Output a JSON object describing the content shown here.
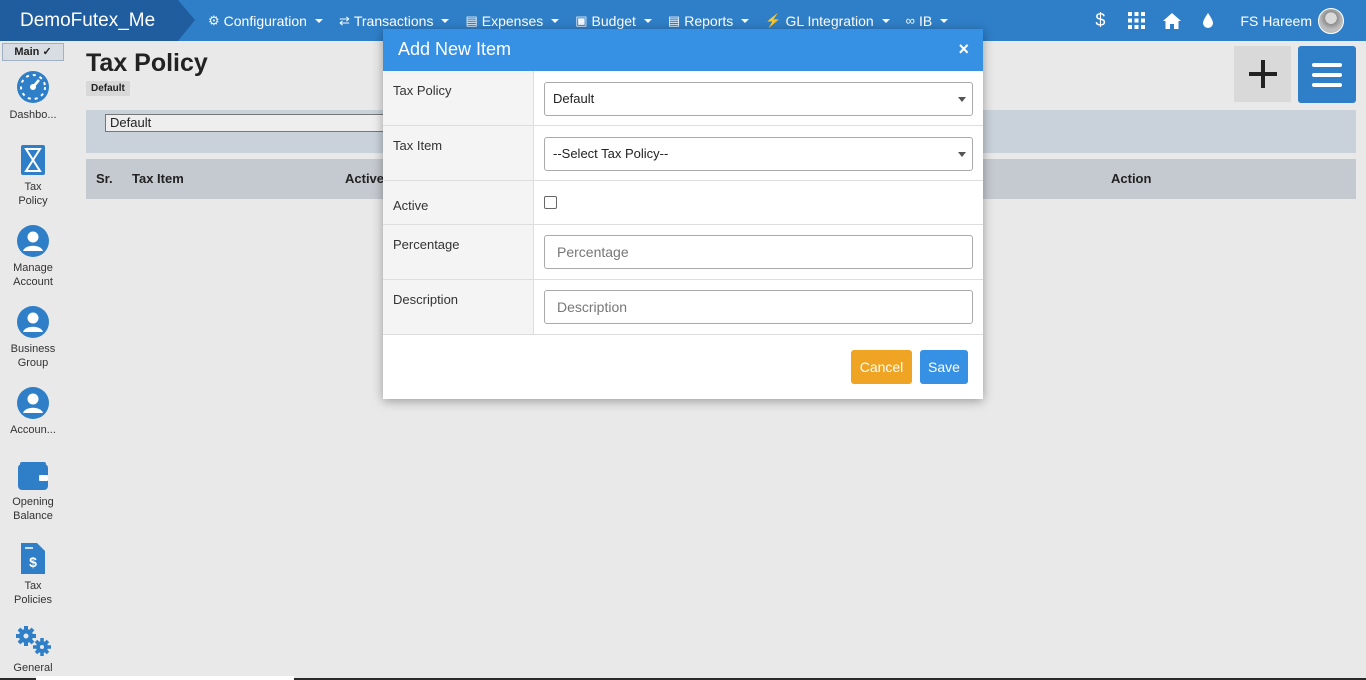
{
  "app": {
    "brand": "DemoFutex_Me"
  },
  "nav": {
    "items": [
      {
        "label": "Configuration",
        "icon": "gears-icon"
      },
      {
        "label": "Transactions",
        "icon": "exchange-icon"
      },
      {
        "label": "Expenses",
        "icon": "document-icon"
      },
      {
        "label": "Budget",
        "icon": "wallet-icon"
      },
      {
        "label": "Reports",
        "icon": "report-icon"
      },
      {
        "label": "GL Integration",
        "icon": "plug-icon"
      },
      {
        "label": "IB",
        "icon": "link-icon"
      }
    ],
    "right_icons": [
      "dollar-icon",
      "grid-icon",
      "home-icon",
      "drop-icon"
    ],
    "user_name": "FS Hareem"
  },
  "sidebar": {
    "main_tag": "Main ✓",
    "items": [
      {
        "label": "Dashbo...",
        "icon": "dashboard-icon"
      },
      {
        "label": "Tax Policy",
        "icon": "hourglass-icon"
      },
      {
        "label": "Manage Account",
        "icon": "user-icon"
      },
      {
        "label": "Business Group",
        "icon": "user-icon"
      },
      {
        "label": "Accoun...",
        "icon": "user-icon"
      },
      {
        "label": "Opening Balance",
        "icon": "wallet-icon"
      },
      {
        "label": "Tax Policies",
        "icon": "invoice-icon"
      },
      {
        "label": "General",
        "icon": "gears-icon"
      }
    ]
  },
  "page": {
    "title": "Tax Policy",
    "badge": "Default",
    "filter_value": "Default",
    "table": {
      "headers": [
        "Sr.",
        "Tax Item",
        "Active",
        "Action"
      ]
    }
  },
  "modal": {
    "title": "Add New Item",
    "close_glyph": "×",
    "fields": {
      "tax_policy": {
        "label": "Tax Policy",
        "value": "Default"
      },
      "tax_item": {
        "label": "Tax Item",
        "value": "--Select Tax Policy--"
      },
      "active": {
        "label": "Active",
        "checked": false
      },
      "percentage": {
        "label": "Percentage",
        "placeholder": "Percentage"
      },
      "description": {
        "label": "Description",
        "placeholder": "Description"
      }
    },
    "cancel_label": "Cancel",
    "save_label": "Save"
  },
  "colors": {
    "nav_blue": "#2f7fc8",
    "brand_dark": "#1f5d9e",
    "modal_header": "#3690e3",
    "cancel_orange": "#f0a423"
  }
}
